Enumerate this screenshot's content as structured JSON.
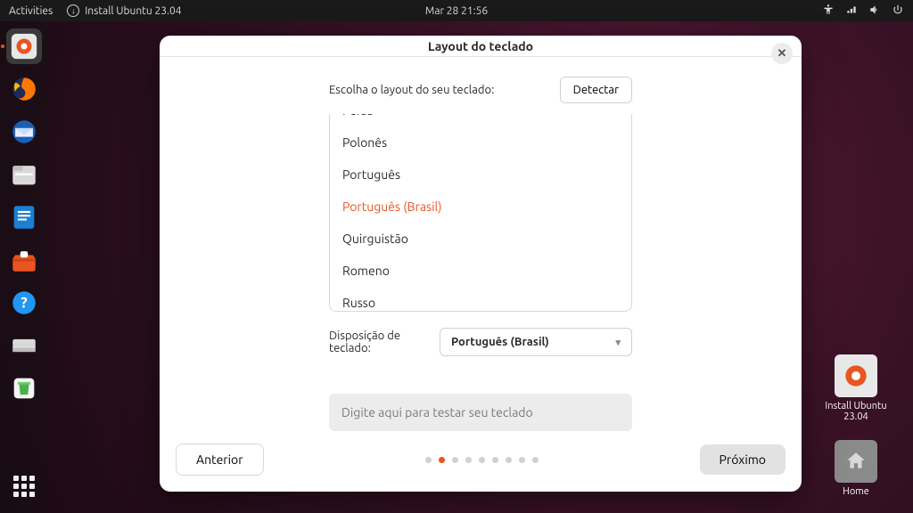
{
  "topbar": {
    "activities": "Activities",
    "app_indicator": "Install Ubuntu 23.04",
    "clock": "Mar 28  21:56"
  },
  "desktop": {
    "install_label_1": "Install Ubuntu",
    "install_label_2": "23.04",
    "home_label": "Home"
  },
  "window": {
    "title": "Layout do teclado",
    "choose_label": "Escolha o layout do seu teclado:",
    "detect_label": "Detectar",
    "list": {
      "0": "Persa",
      "1": "Polonês",
      "2": "Português",
      "3": "Português (Brasil)",
      "4": "Quirguistão",
      "5": "Romeno",
      "6": "Russo"
    },
    "layout_label": "Disposição de teclado:",
    "layout_selected": "Português (Brasil)",
    "test_placeholder": "Digite aqui para testar seu teclado",
    "prev": "Anterior",
    "next": "Próximo"
  },
  "steps": {
    "total": 9,
    "active_index": 1
  },
  "colors": {
    "accent": "#e95420"
  }
}
